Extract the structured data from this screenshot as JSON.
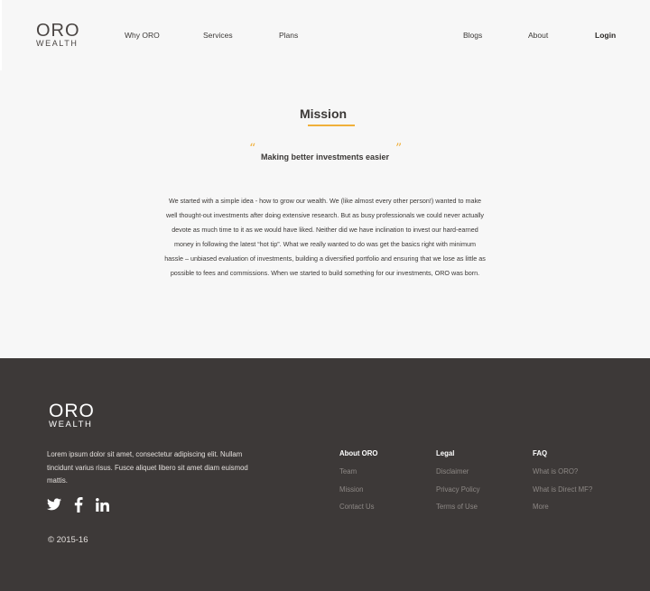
{
  "header": {
    "logo": {
      "oro": "ORO",
      "wealth": "WEALTH"
    },
    "nav_left": [
      "Why ORO",
      "Services",
      "Plans"
    ],
    "nav_right": [
      "Blogs",
      "About"
    ],
    "login": "Login"
  },
  "mission": {
    "title": "Mission",
    "open_quote": "“",
    "close_quote": "”",
    "tagline": "Making better investments easier",
    "body": "We started with a simple idea - how to grow our wealth. We (like almost every other person!) wanted to make well thought-out investments after doing extensive research. But as busy professionals we could never actually devote as much time to it as we would have liked. Neither did we have inclination to invest our hard-earned money in following the latest “hot tip”. What we really wanted to do was get the basics right with minimum hassle – unbiased evaluation of investments, building a diversified portfolio and ensuring that we lose as little as possible to fees and commissions. When we started to build something for our investments, ORO was born."
  },
  "footer": {
    "logo": {
      "oro": "ORO",
      "wealth": "WEALTH"
    },
    "description": "Lorem ipsum dolor sit amet, consectetur adipiscing elit. Nullam tincidunt varius risus. Fusce aliquet libero sit amet diam euismod mattis.",
    "social": [
      "twitter-icon",
      "facebook-icon",
      "linkedin-icon"
    ],
    "copyright": "© 2015-16",
    "columns": [
      {
        "head": "About ORO",
        "links": [
          "Team",
          "Mission",
          "Contact Us"
        ]
      },
      {
        "head": "Legal",
        "links": [
          "Disclaimer",
          "Privacy Policy",
          "Terms of Use"
        ]
      },
      {
        "head": "FAQ",
        "links": [
          "What is ORO?",
          "What is Direct MF?",
          "More"
        ]
      }
    ]
  },
  "colors": {
    "accent": "#f0b03a",
    "footer_bg": "#3d3938",
    "page_bg": "#f7f7f7"
  }
}
